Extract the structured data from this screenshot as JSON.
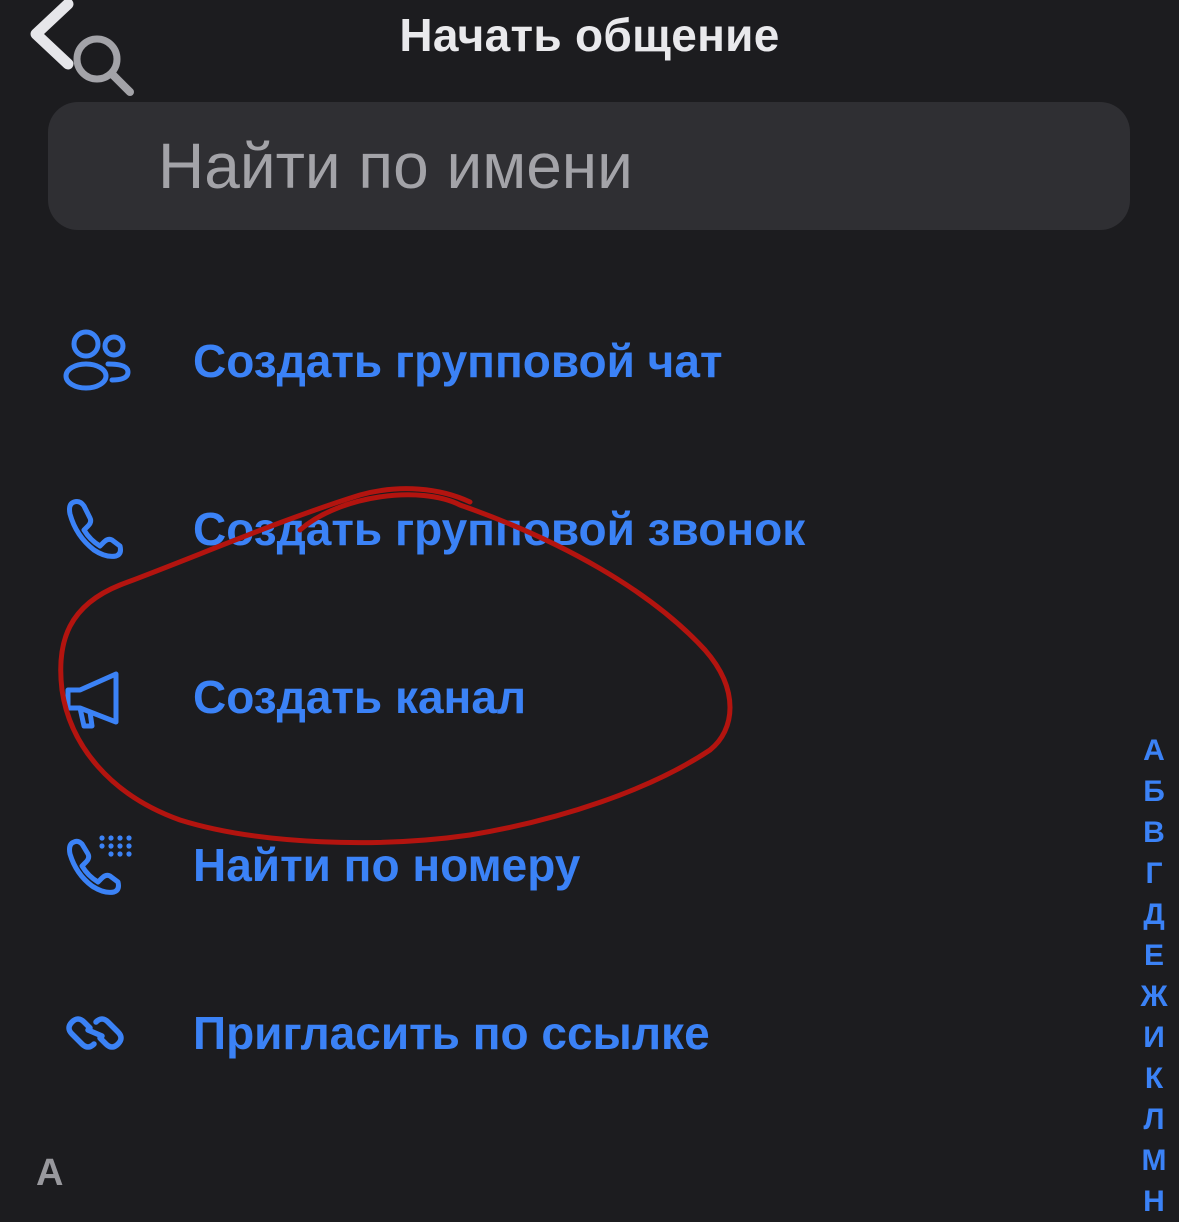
{
  "header": {
    "title": "Начать общение",
    "back_icon": "chevron-left-icon"
  },
  "search": {
    "placeholder": "Найти по имени",
    "value": "",
    "icon": "search-icon"
  },
  "menu": {
    "items": [
      {
        "label": "Создать групповой чат",
        "icon": "group-users-icon"
      },
      {
        "label": "Создать групповой звонок",
        "icon": "phone-icon"
      },
      {
        "label": "Создать канал",
        "icon": "megaphone-icon"
      },
      {
        "label": "Найти по номеру",
        "icon": "phone-keypad-icon"
      },
      {
        "label": "Пригласить по ссылке",
        "icon": "link-icon"
      }
    ]
  },
  "alphabet_index": [
    "А",
    "Б",
    "В",
    "Г",
    "Д",
    "Е",
    "Ж",
    "И",
    "К",
    "Л",
    "М",
    "Н"
  ],
  "section_header": "А",
  "colors": {
    "background": "#1c1c1f",
    "accent": "#3b82f6",
    "search_bg": "#2f2f33",
    "annotation": "#b3140f"
  },
  "annotation": {
    "shape": "hand-drawn red ellipse",
    "target": "Создать канал"
  }
}
